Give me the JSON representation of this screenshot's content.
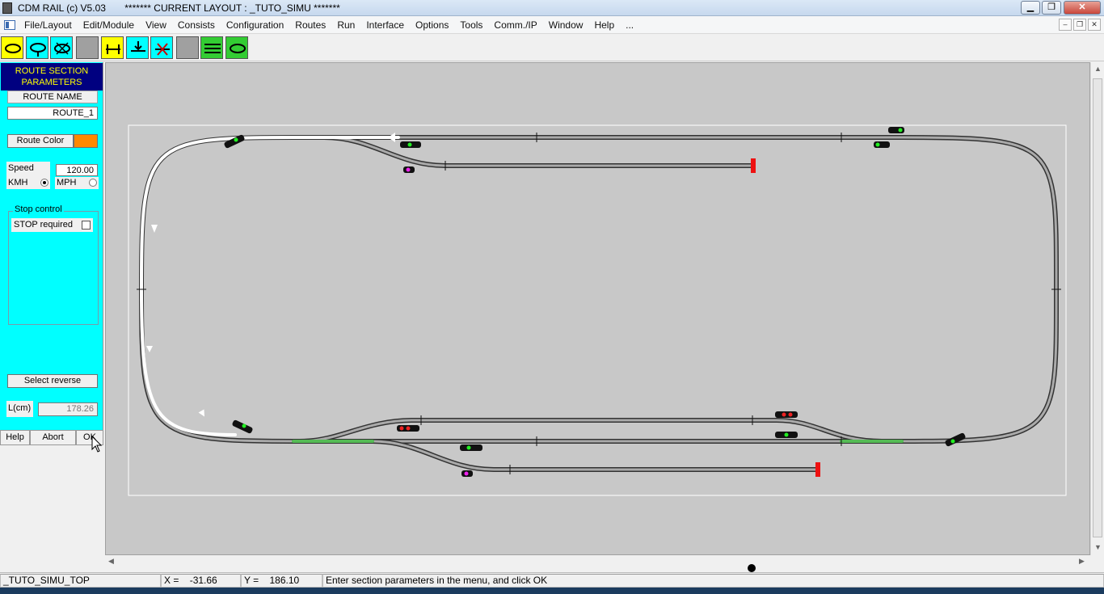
{
  "window": {
    "title": "CDM RAIL (c) V5.03",
    "layout_title": "******* CURRENT LAYOUT : _TUTO_SIMU *******"
  },
  "menu": [
    "File/Layout",
    "Edit/Module",
    "View",
    "Consists",
    "Configuration",
    "Routes",
    "Run",
    "Interface",
    "Options",
    "Tools",
    "Comm./IP",
    "Window",
    "Help",
    "..."
  ],
  "toolbar": {
    "buttons": [
      {
        "name": "loop-yellow-icon",
        "color": "#ffff00"
      },
      {
        "name": "loop-reverse-cyan-icon",
        "color": "#00ffff"
      },
      {
        "name": "loop-cross-cyan-icon",
        "color": "#00ffff"
      },
      {
        "name": "disabled-gray-icon",
        "color": "#a0a0a0"
      },
      {
        "name": "switch-yellow-icon",
        "color": "#ffff00"
      },
      {
        "name": "switch-down-cyan-icon",
        "color": "#00ffff"
      },
      {
        "name": "switch-cross-cyan-icon",
        "color": "#00ffff"
      },
      {
        "name": "disabled-gray-icon-2",
        "color": "#a0a0a0"
      },
      {
        "name": "lines-green-icon",
        "color": "#33cc33"
      },
      {
        "name": "loop-green-icon",
        "color": "#33cc33"
      }
    ]
  },
  "panel": {
    "header": "ROUTE SECTION PARAMETERS",
    "route_name_label": "ROUTE NAME",
    "route_name_value": "ROUTE_1",
    "route_color_label": "Route Color",
    "route_color": "#ff8800",
    "speed_label": "Speed",
    "speed_value": "120.00",
    "kmh_label": "KMH",
    "mph_label": "MPH",
    "stop_control_label": "Stop control",
    "stop_required_label": "STOP required",
    "select_reverse_label": "Select reverse",
    "length_label": "L(cm)",
    "length_value": "178.26",
    "help_label": "Help",
    "abort_label": "Abort",
    "ok_label": "OK"
  },
  "statusbar": {
    "layout_name": "_TUTO_SIMU_TOP",
    "x_label": "X =",
    "x_value": "-31.66",
    "y_label": "Y =",
    "y_value": "186.10",
    "message": "Enter section parameters in the menu, and click OK"
  },
  "colors": {
    "canvas_bg": "#c8c8c8",
    "track": "#999999",
    "route_highlight": "#ffffff",
    "green_section": "#55bb55",
    "buffer_stop": "#ee1111"
  }
}
